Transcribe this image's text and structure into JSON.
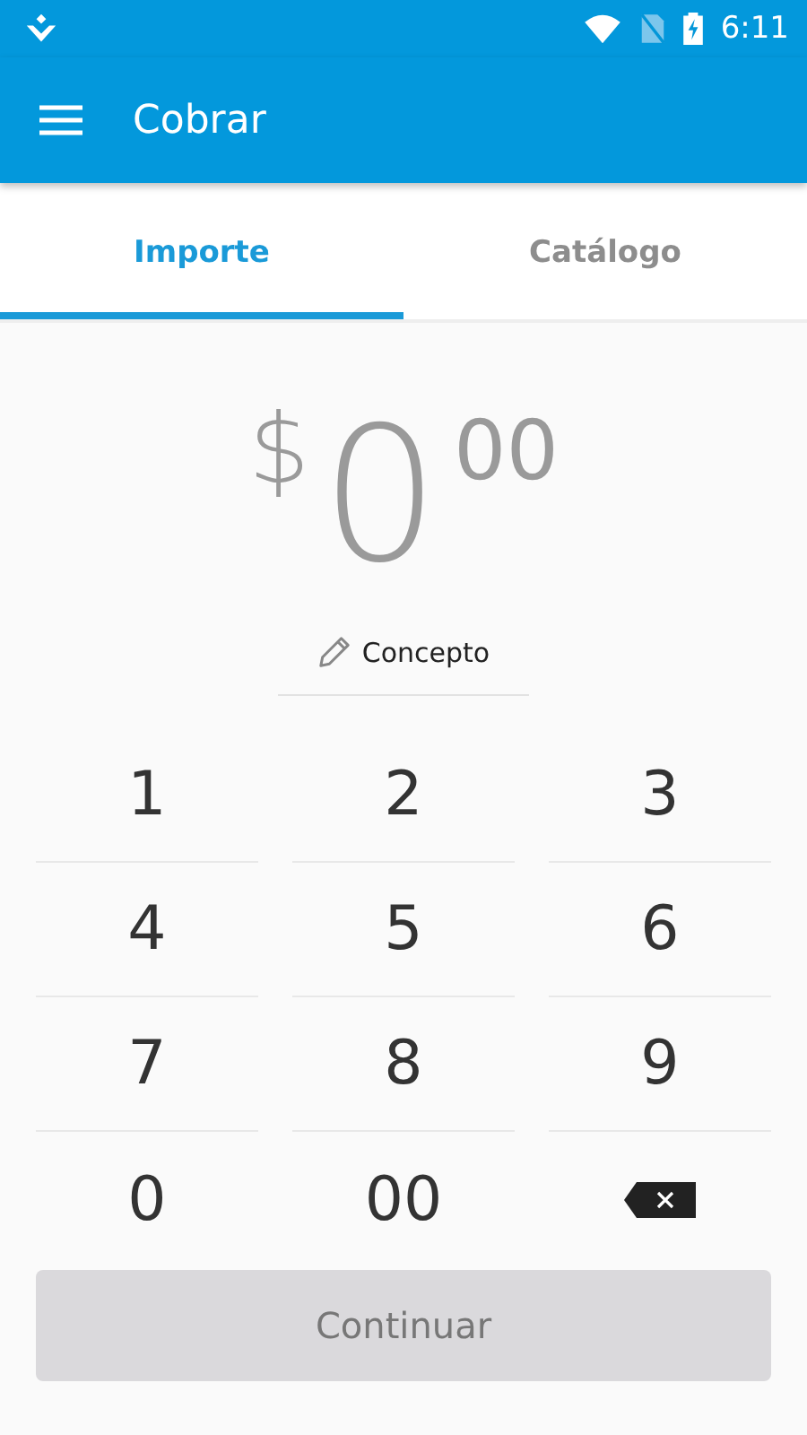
{
  "status_bar": {
    "time": "6:11"
  },
  "app_bar": {
    "title": "Cobrar"
  },
  "tabs": [
    {
      "label": "Importe",
      "selected": true
    },
    {
      "label": "Catálogo",
      "selected": false
    }
  ],
  "amount": {
    "currency": "$",
    "whole": "0",
    "cents": "00"
  },
  "concept": {
    "placeholder": "Concepto"
  },
  "keypad": [
    {
      "kind": "digit",
      "label": "1"
    },
    {
      "kind": "digit",
      "label": "2"
    },
    {
      "kind": "digit",
      "label": "3"
    },
    {
      "kind": "digit",
      "label": "4"
    },
    {
      "kind": "digit",
      "label": "5"
    },
    {
      "kind": "digit",
      "label": "6"
    },
    {
      "kind": "digit",
      "label": "7"
    },
    {
      "kind": "digit",
      "label": "8"
    },
    {
      "kind": "digit",
      "label": "9"
    },
    {
      "kind": "digit",
      "label": "0"
    },
    {
      "kind": "digit",
      "label": "00"
    },
    {
      "kind": "backspace"
    }
  ],
  "continue_button": {
    "label": "Continuar",
    "disabled": true
  }
}
